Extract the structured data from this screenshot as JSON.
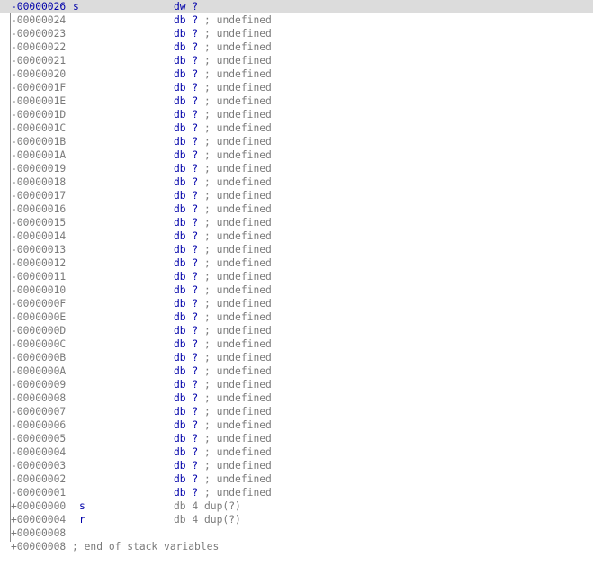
{
  "rows": [
    {
      "offset": "-00000026",
      "name": "s",
      "kw": "dw",
      "q": "?",
      "cm": "",
      "hl": true
    },
    {
      "offset": "-00000024",
      "name": "",
      "kw": "db",
      "q": "?",
      "cm": "; undefined"
    },
    {
      "offset": "-00000023",
      "name": "",
      "kw": "db",
      "q": "?",
      "cm": "; undefined"
    },
    {
      "offset": "-00000022",
      "name": "",
      "kw": "db",
      "q": "?",
      "cm": "; undefined"
    },
    {
      "offset": "-00000021",
      "name": "",
      "kw": "db",
      "q": "?",
      "cm": "; undefined"
    },
    {
      "offset": "-00000020",
      "name": "",
      "kw": "db",
      "q": "?",
      "cm": "; undefined"
    },
    {
      "offset": "-0000001F",
      "name": "",
      "kw": "db",
      "q": "?",
      "cm": "; undefined"
    },
    {
      "offset": "-0000001E",
      "name": "",
      "kw": "db",
      "q": "?",
      "cm": "; undefined"
    },
    {
      "offset": "-0000001D",
      "name": "",
      "kw": "db",
      "q": "?",
      "cm": "; undefined"
    },
    {
      "offset": "-0000001C",
      "name": "",
      "kw": "db",
      "q": "?",
      "cm": "; undefined"
    },
    {
      "offset": "-0000001B",
      "name": "",
      "kw": "db",
      "q": "?",
      "cm": "; undefined"
    },
    {
      "offset": "-0000001A",
      "name": "",
      "kw": "db",
      "q": "?",
      "cm": "; undefined"
    },
    {
      "offset": "-00000019",
      "name": "",
      "kw": "db",
      "q": "?",
      "cm": "; undefined"
    },
    {
      "offset": "-00000018",
      "name": "",
      "kw": "db",
      "q": "?",
      "cm": "; undefined"
    },
    {
      "offset": "-00000017",
      "name": "",
      "kw": "db",
      "q": "?",
      "cm": "; undefined"
    },
    {
      "offset": "-00000016",
      "name": "",
      "kw": "db",
      "q": "?",
      "cm": "; undefined"
    },
    {
      "offset": "-00000015",
      "name": "",
      "kw": "db",
      "q": "?",
      "cm": "; undefined"
    },
    {
      "offset": "-00000014",
      "name": "",
      "kw": "db",
      "q": "?",
      "cm": "; undefined"
    },
    {
      "offset": "-00000013",
      "name": "",
      "kw": "db",
      "q": "?",
      "cm": "; undefined"
    },
    {
      "offset": "-00000012",
      "name": "",
      "kw": "db",
      "q": "?",
      "cm": "; undefined"
    },
    {
      "offset": "-00000011",
      "name": "",
      "kw": "db",
      "q": "?",
      "cm": "; undefined"
    },
    {
      "offset": "-00000010",
      "name": "",
      "kw": "db",
      "q": "?",
      "cm": "; undefined"
    },
    {
      "offset": "-0000000F",
      "name": "",
      "kw": "db",
      "q": "?",
      "cm": "; undefined"
    },
    {
      "offset": "-0000000E",
      "name": "",
      "kw": "db",
      "q": "?",
      "cm": "; undefined"
    },
    {
      "offset": "-0000000D",
      "name": "",
      "kw": "db",
      "q": "?",
      "cm": "; undefined"
    },
    {
      "offset": "-0000000C",
      "name": "",
      "kw": "db",
      "q": "?",
      "cm": "; undefined"
    },
    {
      "offset": "-0000000B",
      "name": "",
      "kw": "db",
      "q": "?",
      "cm": "; undefined"
    },
    {
      "offset": "-0000000A",
      "name": "",
      "kw": "db",
      "q": "?",
      "cm": "; undefined"
    },
    {
      "offset": "-00000009",
      "name": "",
      "kw": "db",
      "q": "?",
      "cm": "; undefined"
    },
    {
      "offset": "-00000008",
      "name": "",
      "kw": "db",
      "q": "?",
      "cm": "; undefined"
    },
    {
      "offset": "-00000007",
      "name": "",
      "kw": "db",
      "q": "?",
      "cm": "; undefined"
    },
    {
      "offset": "-00000006",
      "name": "",
      "kw": "db",
      "q": "?",
      "cm": "; undefined"
    },
    {
      "offset": "-00000005",
      "name": "",
      "kw": "db",
      "q": "?",
      "cm": "; undefined"
    },
    {
      "offset": "-00000004",
      "name": "",
      "kw": "db",
      "q": "?",
      "cm": "; undefined"
    },
    {
      "offset": "-00000003",
      "name": "",
      "kw": "db",
      "q": "?",
      "cm": "; undefined"
    },
    {
      "offset": "-00000002",
      "name": "",
      "kw": "db",
      "q": "?",
      "cm": "; undefined"
    },
    {
      "offset": "-00000001",
      "name": "",
      "kw": "db",
      "q": "?",
      "cm": "; undefined"
    },
    {
      "offset": "+00000000",
      "name": "s",
      "kw": "db 4 dup(?)",
      "q": "",
      "cm": "",
      "lo": true
    },
    {
      "offset": "+00000004",
      "name": "r",
      "kw": "db 4 dup(?)",
      "q": "",
      "cm": "",
      "lo": true
    },
    {
      "offset": "+00000008",
      "name": "",
      "kw": "",
      "q": "",
      "cm": ""
    },
    {
      "offset": "+00000008 ; end of stack variables",
      "name": "",
      "kw": "",
      "q": "",
      "cm": ""
    }
  ],
  "colors": {
    "offset_text": "#7a7a7a",
    "keyword": "#0000aa",
    "comment": "#7a7a7a",
    "highlight_bg": "#dcdcdc"
  }
}
